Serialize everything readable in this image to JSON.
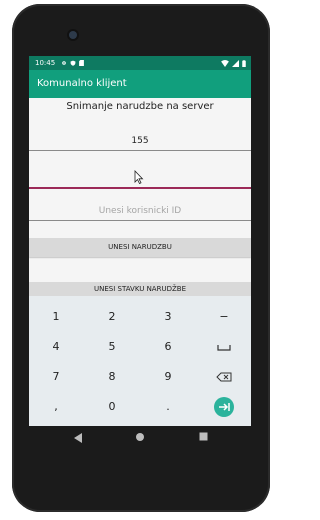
{
  "status_bar": {
    "time": "10:45"
  },
  "app_bar": {
    "title": "Komunalno klijent"
  },
  "form": {
    "heading": "Snimanje narudzbe na server",
    "field1_value": "155",
    "field2_value": "",
    "user_id_placeholder": "Unesi korisnicki ID"
  },
  "buttons": {
    "enter_order": "UNESI NARUDZBU",
    "enter_order_item": "UNESI STAVKU NARUDŽBE"
  },
  "keyboard": {
    "keys": [
      "1",
      "2",
      "3",
      "−",
      "4",
      "5",
      "6",
      "␣",
      "7",
      "8",
      "9",
      "⌫",
      ",",
      "0",
      ".",
      "→"
    ]
  },
  "colors": {
    "status_bar": "#0e7a61",
    "app_bar": "#119f7d",
    "accent": "#9c2a58",
    "keyboard_bg": "#e7ecef",
    "enter_key": "#2bb39c"
  }
}
